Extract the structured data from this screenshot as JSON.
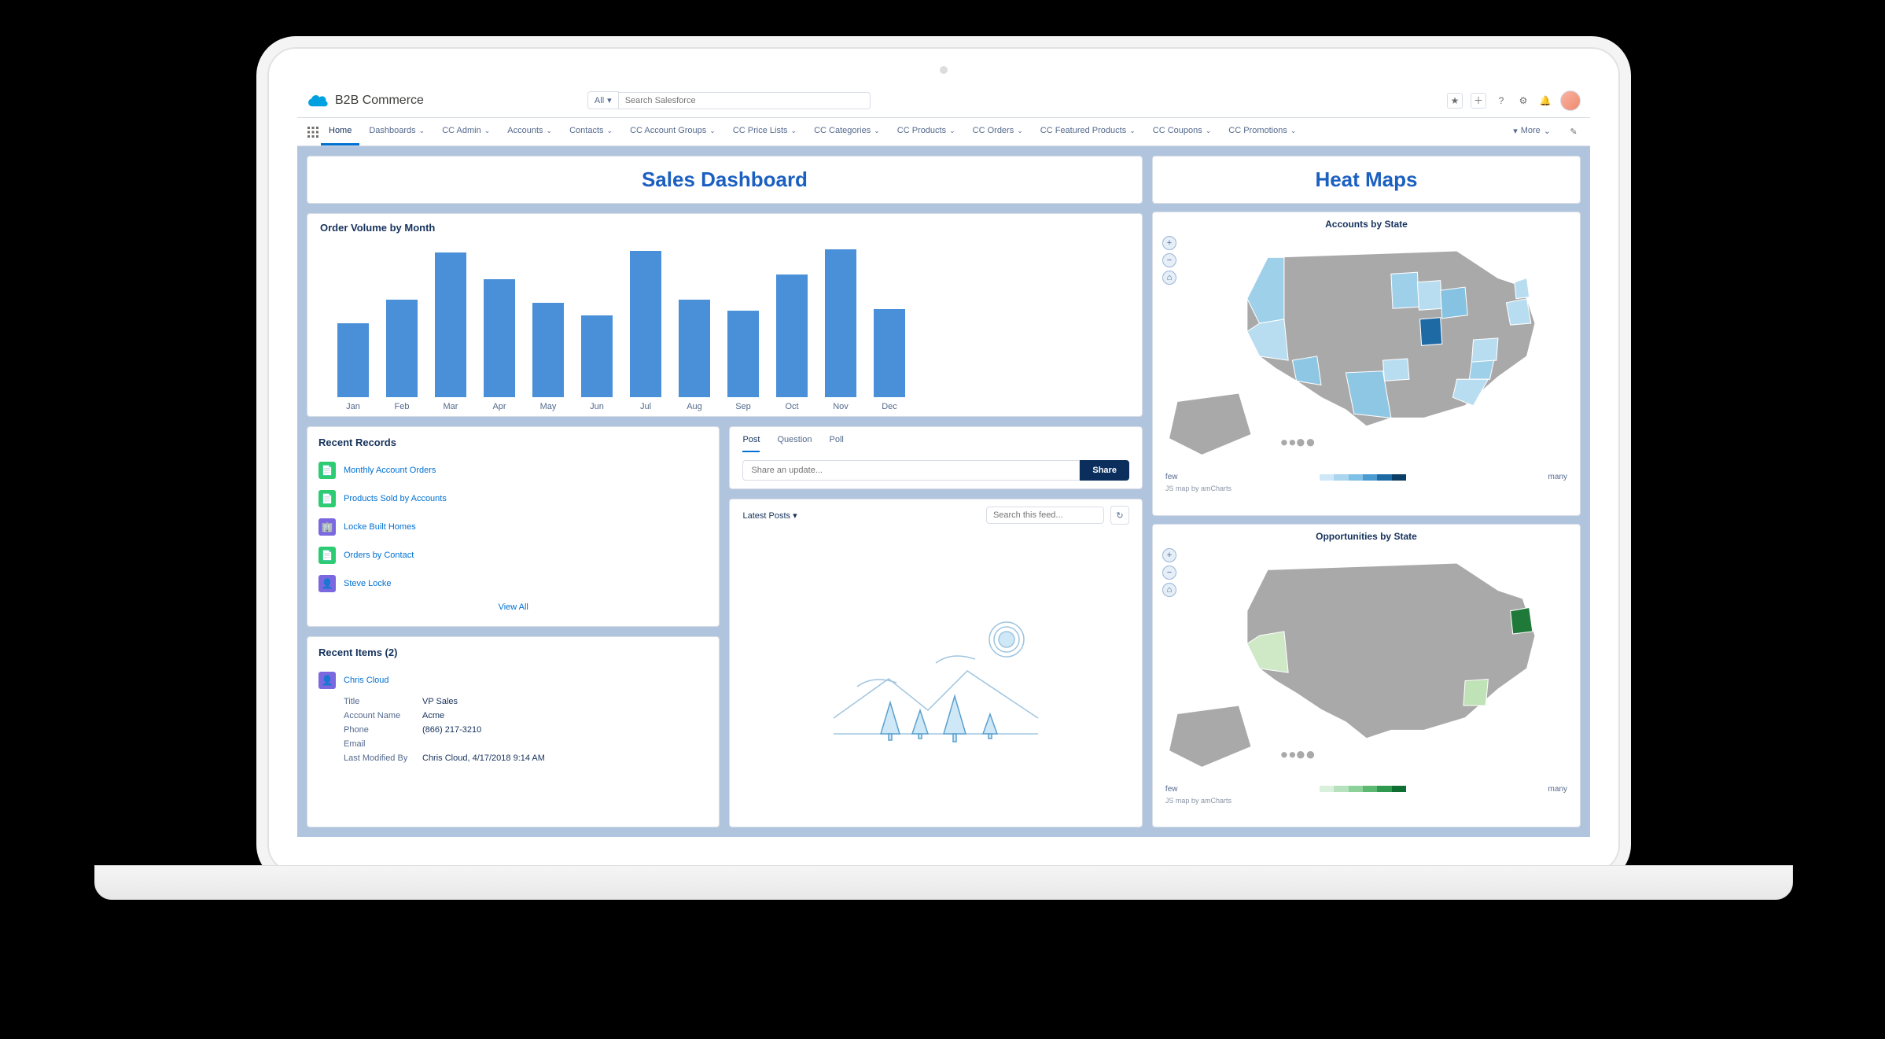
{
  "header": {
    "app_name": "B2B Commerce",
    "search_scope": "All",
    "search_placeholder": "Search Salesforce"
  },
  "nav": {
    "items": [
      "Home",
      "Dashboards",
      "CC Admin",
      "Accounts",
      "Contacts",
      "CC Account Groups",
      "CC Price Lists",
      "CC Categories",
      "CC Products",
      "CC Orders",
      "CC Featured Products",
      "CC Coupons",
      "CC Promotions"
    ],
    "more_label": "More"
  },
  "left_title": "Sales Dashboard",
  "right_title": "Heat Maps",
  "chart_data": {
    "type": "bar",
    "title": "Order Volume by Month",
    "categories": [
      "Jan",
      "Feb",
      "Mar",
      "Apr",
      "May",
      "Jun",
      "Jul",
      "Aug",
      "Sep",
      "Oct",
      "Nov",
      "Dec"
    ],
    "values": [
      47,
      62,
      92,
      75,
      60,
      52,
      93,
      62,
      55,
      78,
      94,
      56
    ],
    "ylim": [
      0,
      100
    ]
  },
  "recent_records": {
    "title": "Recent Records",
    "items": [
      {
        "label": "Monthly Account Orders",
        "icon": "report",
        "color": "#2ecc71"
      },
      {
        "label": "Products Sold by Accounts",
        "icon": "report",
        "color": "#2ecc71"
      },
      {
        "label": "Locke Built Homes",
        "icon": "account",
        "color": "#7a68e0"
      },
      {
        "label": "Orders by Contact",
        "icon": "report",
        "color": "#2ecc71"
      },
      {
        "label": "Steve Locke",
        "icon": "contact",
        "color": "#7a68e0"
      }
    ],
    "view_all": "View All"
  },
  "recent_items": {
    "title": "Recent Items (2)",
    "record_name": "Chris Cloud",
    "rows": [
      {
        "label": "Title",
        "value": "VP Sales"
      },
      {
        "label": "Account Name",
        "value": "Acme"
      },
      {
        "label": "Phone",
        "value": "(866) 217-3210"
      },
      {
        "label": "Email",
        "value": ""
      },
      {
        "label": "Last Modified By",
        "value": "Chris Cloud, 4/17/2018 9:14 AM"
      }
    ]
  },
  "feed": {
    "tabs": [
      "Post",
      "Question",
      "Poll"
    ],
    "share_placeholder": "Share an update...",
    "share_button": "Share",
    "latest_label": "Latest Posts",
    "search_placeholder": "Search this feed..."
  },
  "maps": {
    "accounts_title": "Accounts by State",
    "opps_title": "Opportunities by State",
    "legend_low": "few",
    "legend_high": "many",
    "credit": "JS map by amCharts",
    "blue_scale": [
      "#cfe8f7",
      "#a9d5ef",
      "#7fc0e6",
      "#4a9bd1",
      "#1d6aa5",
      "#0b3e66"
    ],
    "green_scale": [
      "#d9f0dc",
      "#b5e2bc",
      "#8cd19a",
      "#5db971",
      "#2f9a4f",
      "#0f6e32"
    ]
  }
}
